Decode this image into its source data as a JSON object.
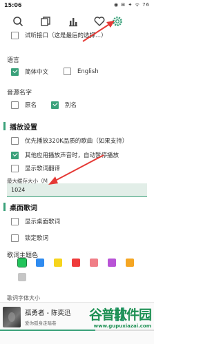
{
  "status": {
    "time": "15:06",
    "icons": "◉ ⊞ ✦ ᯤ 76"
  },
  "toolbar": {
    "icons": [
      "search-icon",
      "copy-icon",
      "chart-icon",
      "heart-icon",
      "gear-icon"
    ],
    "accent": "#3aa17a"
  },
  "options": {
    "trial_api": "试听接口（这是最后的选择...）",
    "language_label": "语言",
    "lang_zh": "简体中文",
    "lang_en": "English",
    "source_name_label": "音源名字",
    "src_original": "原名",
    "src_alias": "别名"
  },
  "playback": {
    "title": "播放设置",
    "prefer_320k": "优先播放320K品质的歌曲（如果支持）",
    "auto_pause": "其他应用播放声音时，自动暂停播放",
    "show_translation": "显示歌词翻译",
    "cache_label": "最大缓存大小（M",
    "cache_value": "1024"
  },
  "desktop_lyrics": {
    "title": "桌面歌词",
    "show": "显示桌面歌词",
    "lock": "锁定歌词",
    "theme_label": "歌词主题色",
    "colors": [
      "#21c45b",
      "#2f8bf0",
      "#f6d41d",
      "#ef3b3b",
      "#f07e87",
      "#b853d6",
      "#f5a623",
      "#c6c6c6"
    ],
    "font_size_label": "歌词字体大小"
  },
  "player": {
    "song": "孤勇者 - 陈奕迅",
    "lyric": "爱你孤身走暗巷",
    "progress": 0.62
  },
  "watermark": {
    "logo": "谷普软件园",
    "url": "www.gupuxiazai.com"
  }
}
